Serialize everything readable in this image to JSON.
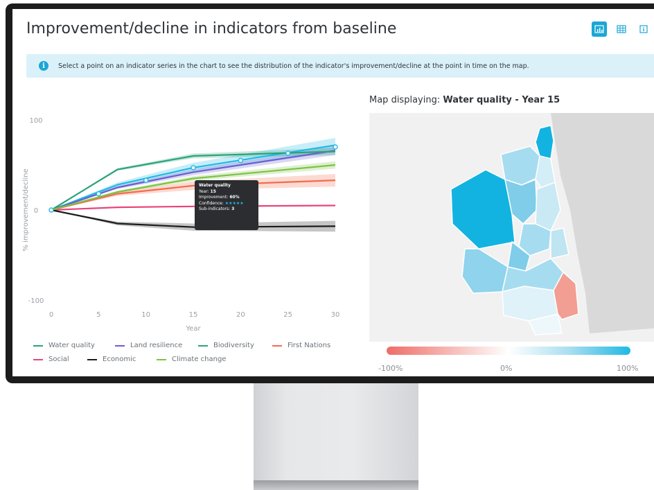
{
  "header": {
    "title": "Improvement/decline in indicators from baseline",
    "toolbar": [
      {
        "icon": "bar-chart-icon",
        "active": true
      },
      {
        "icon": "table-grid-icon",
        "active": false
      },
      {
        "icon": "info-box-icon",
        "active": false
      }
    ]
  },
  "info": {
    "icon": "info-circle-icon",
    "text": "Select a point on an indicator series in the chart to see the distribution of the indicator's improvement/decline at the point in time on the map."
  },
  "chart_data": {
    "type": "line",
    "xlabel": "Year",
    "ylabel": "% improvement/decline",
    "xlim": [
      0,
      30
    ],
    "ylim": [
      -100,
      100
    ],
    "xticks": [
      0,
      5,
      10,
      15,
      20,
      25,
      30
    ],
    "yticks": [
      -100,
      0,
      100
    ],
    "x": [
      0,
      7,
      15,
      30
    ],
    "series": [
      {
        "name": "Water quality",
        "color": "#1eb9e4",
        "values": [
          0,
          28,
          47,
          72
        ],
        "markers": [
          0,
          5,
          10,
          15,
          20,
          25,
          30
        ],
        "marker_values": [
          0,
          18,
          33,
          47,
          55,
          63,
          70
        ],
        "band": 8
      },
      {
        "name": "Land resilience",
        "color": "#6b5fcf",
        "values": [
          0,
          25,
          42,
          66
        ],
        "band": 5
      },
      {
        "name": "Biodiversity",
        "color": "#2aa37a",
        "values": [
          0,
          45,
          60,
          65
        ],
        "band": 4
      },
      {
        "name": "First Nations",
        "color": "#f36b4d",
        "values": [
          0,
          18,
          27,
          33
        ],
        "band": 7
      },
      {
        "name": "Social",
        "color": "#e8457a",
        "values": [
          0,
          3,
          4,
          5
        ],
        "band": 0
      },
      {
        "name": "Economic",
        "color": "#1b1b1b",
        "values": [
          0,
          -15,
          -19,
          -18
        ],
        "band": 6
      },
      {
        "name": "Climate change",
        "color": "#7cc242",
        "values": [
          0,
          20,
          35,
          50
        ],
        "band": 4
      }
    ],
    "tooltip": {
      "title": "Water quality",
      "year_label": "Year:",
      "year": "15",
      "improvement_label": "Improvement:",
      "improvement": "60%",
      "confidence_label": "Confidence:",
      "confidence_stars": "★★★★★",
      "subindicators_label": "Sub-indicators:",
      "subindicators": "3"
    }
  },
  "legend": [
    {
      "name": "Water quality",
      "color": "#2aa37a"
    },
    {
      "name": "Land resilience",
      "color": "#6b5fcf"
    },
    {
      "name": "Biodiversity",
      "color": "#2aa37a"
    },
    {
      "name": "First Nations",
      "color": "#f36b4d"
    },
    {
      "name": "Social",
      "color": "#e8457a"
    },
    {
      "name": "Economic",
      "color": "#1b1b1b"
    },
    {
      "name": "Climate change",
      "color": "#7cc242"
    }
  ],
  "map": {
    "title_prefix": "Map displaying:",
    "title_value": "Water quality - Year 15",
    "scale_labels": [
      "-100%",
      "0%",
      "100%"
    ]
  }
}
